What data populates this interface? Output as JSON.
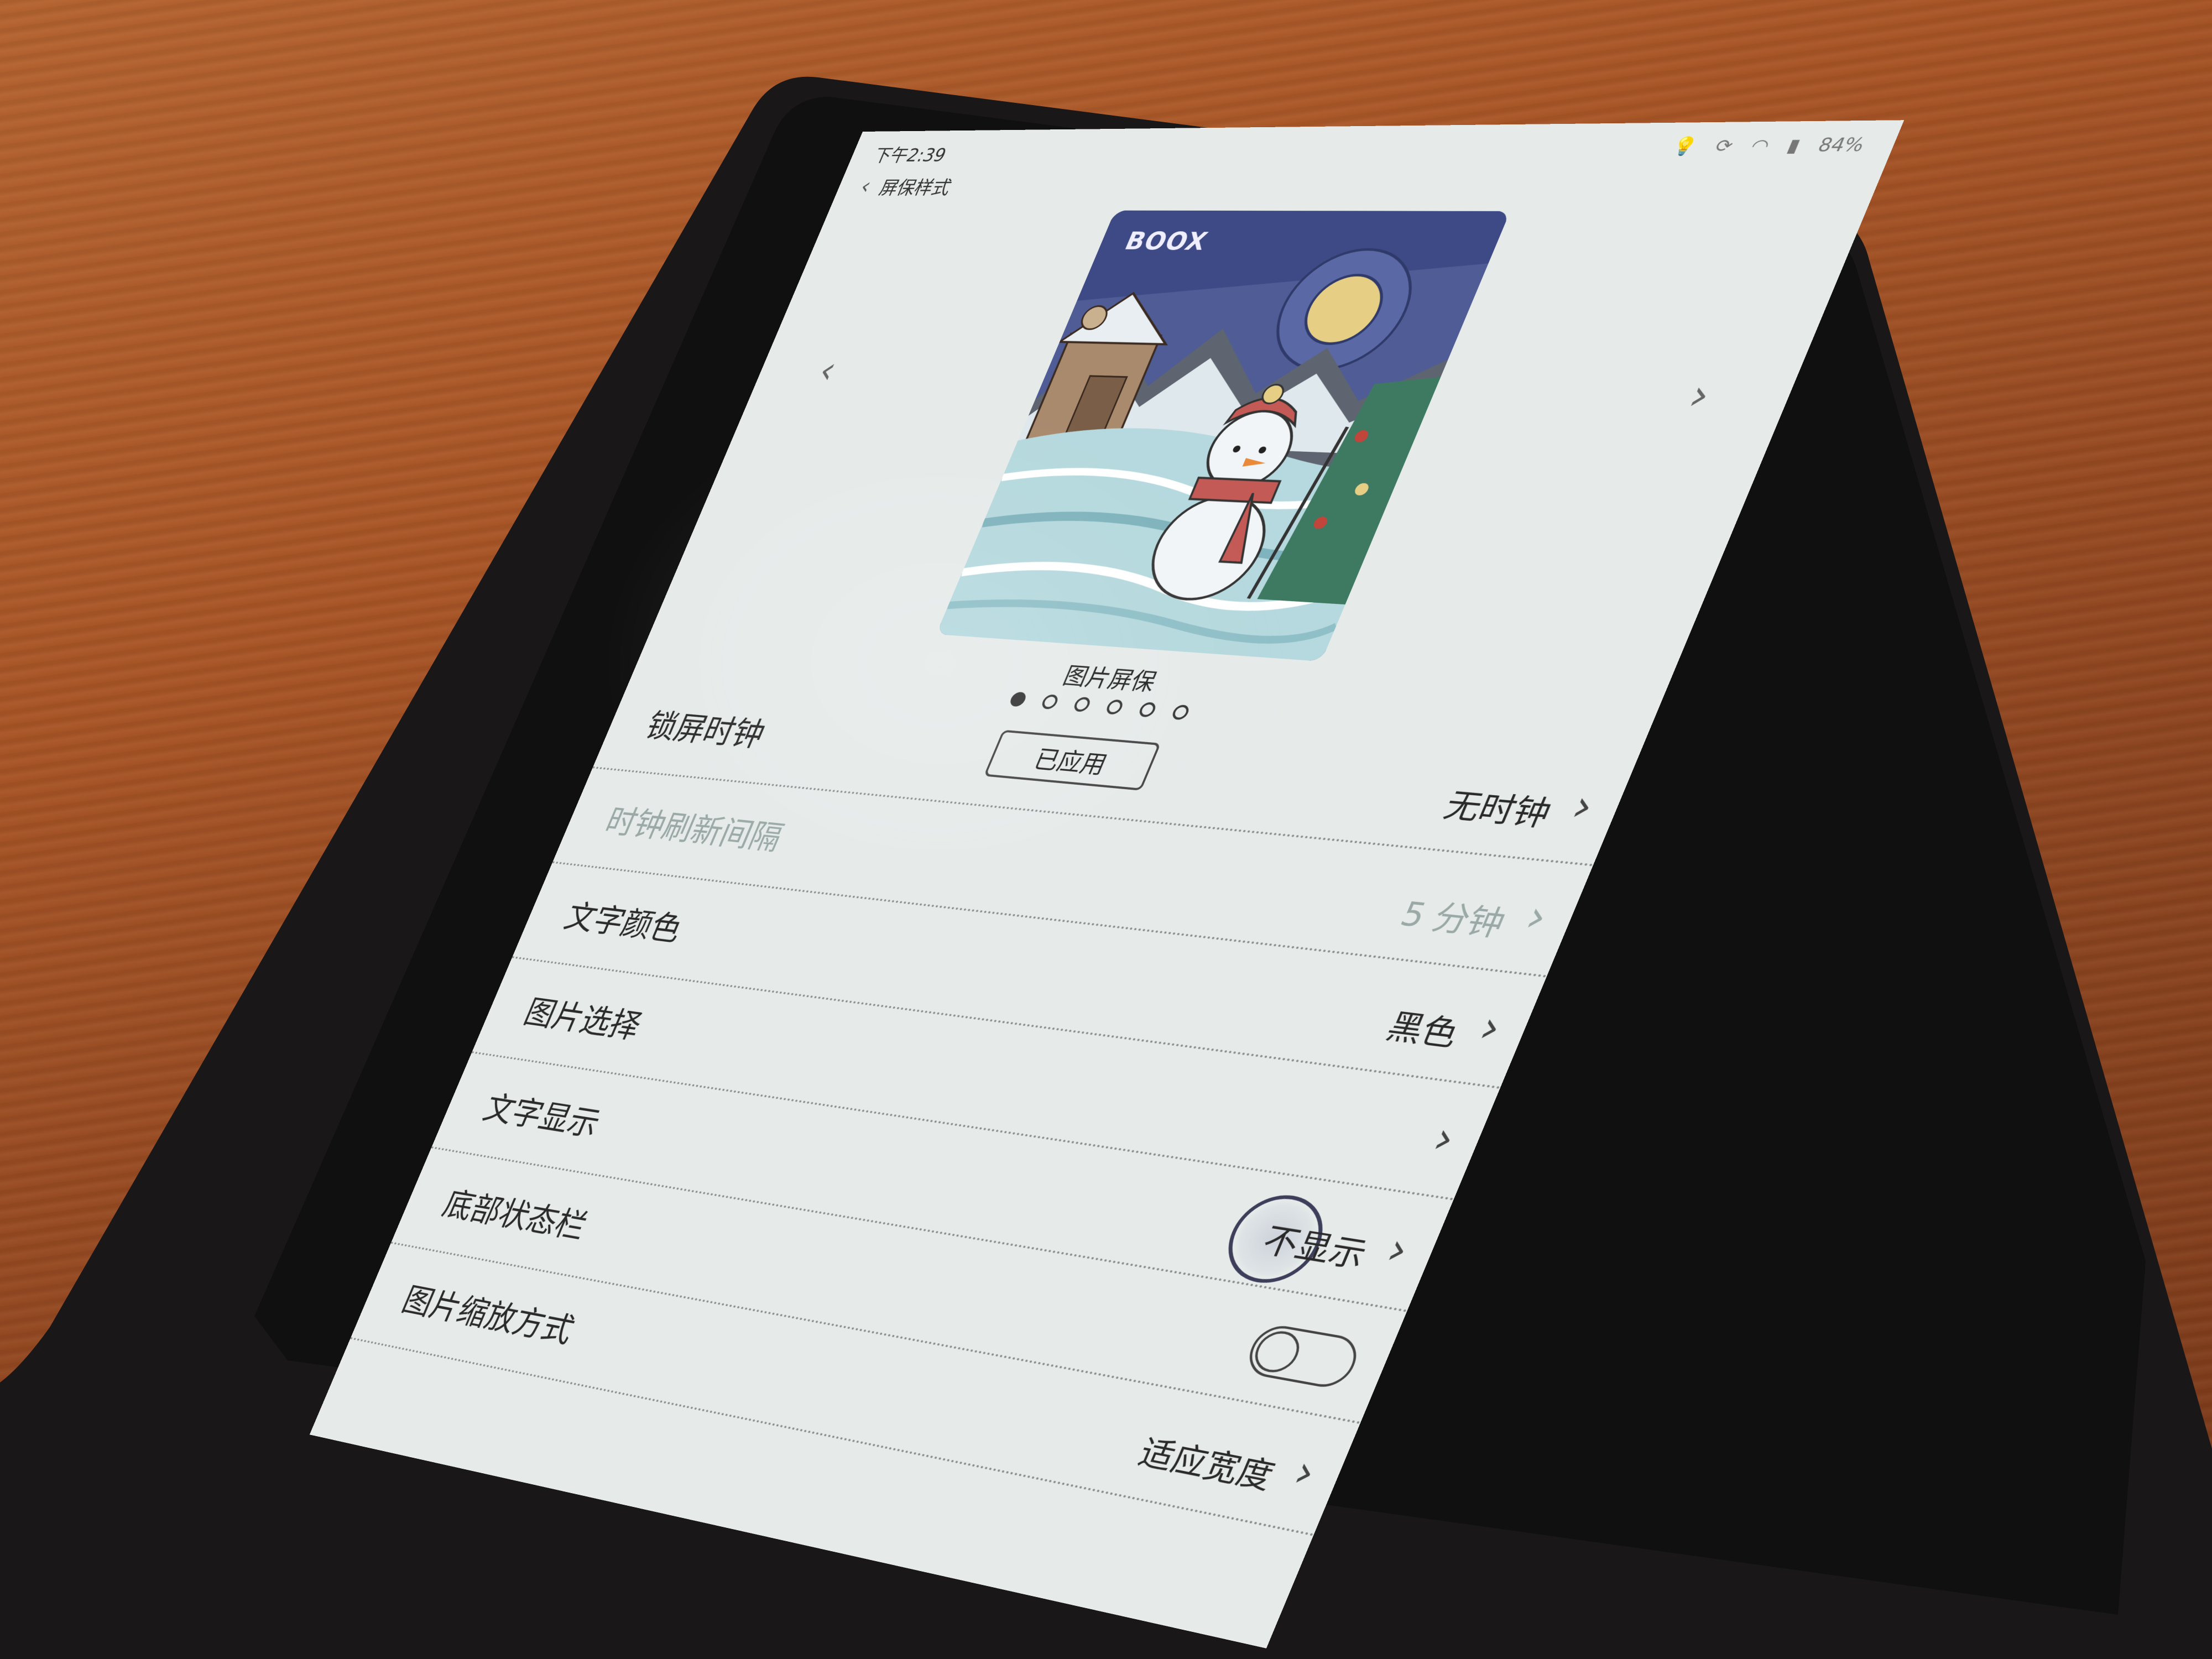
{
  "status_bar": {
    "time": "下午2:39",
    "icons": [
      "bulb-icon",
      "sync-icon",
      "wifi-icon",
      "battery-icon"
    ],
    "battery": "84%"
  },
  "header": {
    "back_icon": "‹",
    "title": "屏保样式"
  },
  "preview": {
    "logo": "BOOX",
    "name": "图片屏保",
    "page_count": 6,
    "active_page": 0,
    "applied_label": "已应用"
  },
  "settings": [
    {
      "label": "锁屏时钟",
      "value": "无时钟",
      "disabled": false,
      "control": "chevron"
    },
    {
      "label": "时钟刷新间隔",
      "value": "5 分钟",
      "disabled": true,
      "control": "chevron"
    },
    {
      "label": "文字颜色",
      "value": "黑色",
      "disabled": false,
      "control": "chevron"
    },
    {
      "label": "图片选择",
      "value": "",
      "disabled": false,
      "control": "chevron"
    },
    {
      "label": "文字显示",
      "value": "不显示",
      "disabled": false,
      "control": "chevron"
    },
    {
      "label": "底部状态栏",
      "value": "",
      "disabled": false,
      "control": "toggle",
      "toggle_on": false
    },
    {
      "label": "图片缩放方式",
      "value": "适应宽度",
      "disabled": false,
      "control": "chevron"
    }
  ],
  "colors": {
    "screen_bg": "#e6ebea",
    "disabled_text": "#9aa9a5",
    "wood": "#a85526"
  }
}
